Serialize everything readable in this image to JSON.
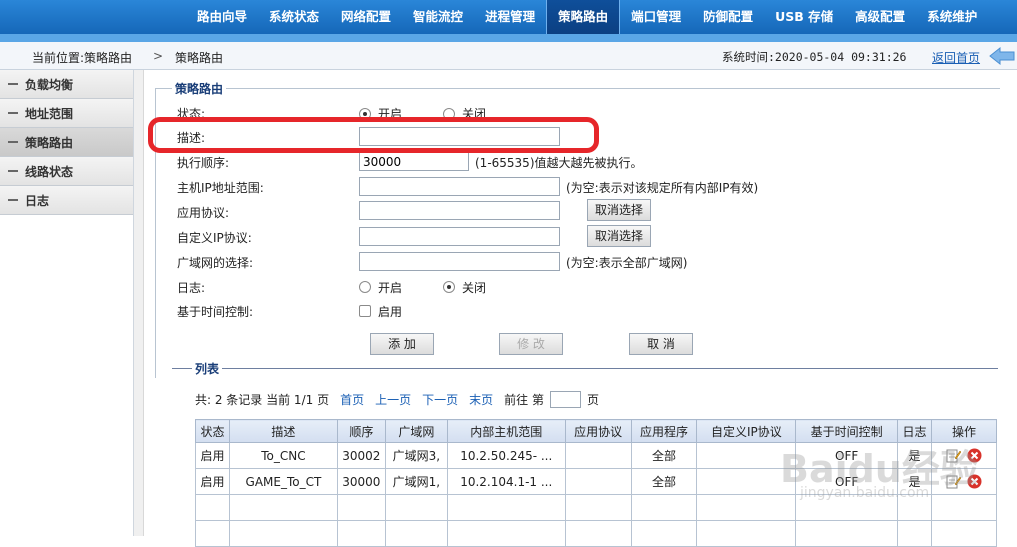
{
  "nav": {
    "items": [
      "路由向导",
      "系统状态",
      "网络配置",
      "智能流控",
      "进程管理",
      "策略路由",
      "端口管理",
      "防御配置",
      "USB 存储",
      "高级配置",
      "系统维护"
    ],
    "active_index": 5
  },
  "breadcrumb": {
    "label": "当前位置:策略路由",
    "separator": ">",
    "page": "策略路由",
    "system_time": "系统时间:2020-05-04 09:31:26",
    "home_link": "返回首页"
  },
  "sidebar": {
    "items": [
      "负载均衡",
      "地址范围",
      "策略路由",
      "线路状态",
      "日志"
    ],
    "active_index": 2
  },
  "form": {
    "legend": "策略路由",
    "status_label": "状态:",
    "status_on": "开启",
    "status_off": "关闭",
    "desc_label": "描述:",
    "desc_value": "",
    "order_label": "执行顺序:",
    "order_value": "30000",
    "order_hint": "(1-65535)值越大越先被执行。",
    "host_ip_label": "主机IP地址范围:",
    "host_ip_value": "",
    "host_ip_hint": "(为空:表示对该规定所有内部IP有效)",
    "app_proto_label": "应用协议:",
    "app_proto_value": "",
    "cancel_select_1": "取消选择",
    "custom_ip_label": "自定义IP协议:",
    "custom_ip_value": "",
    "cancel_select_2": "取消选择",
    "wan_label": "广域网的选择:",
    "wan_value": "",
    "wan_hint": "(为空:表示全部广域网)",
    "log_label": "日志:",
    "log_on": "开启",
    "log_off": "关闭",
    "time_ctrl_label": "基于时间控制:",
    "time_ctrl_enable": "启用",
    "add_button": "添 加",
    "modify_button": "修 改",
    "cancel_button": "取 消"
  },
  "list": {
    "legend": "列表",
    "summary": "共: 2 条记录 当前 1/1 页",
    "first": "首页",
    "prev": "上一页",
    "next": "下一页",
    "last": "末页",
    "goto_prefix": "前往 第",
    "goto_suffix": "页",
    "columns": [
      "状态",
      "描述",
      "顺序",
      "广域网",
      "内部主机范围",
      "应用协议",
      "应用程序",
      "自定义IP协议",
      "基于时间控制",
      "日志",
      "操作"
    ],
    "rows": [
      [
        "启用",
        "To_CNC",
        "30002",
        "广域网3,",
        "10.2.50.245- ...",
        "",
        "全部",
        "",
        "OFF",
        "是"
      ],
      [
        "启用",
        "GAME_To_CT",
        "30000",
        "广域网1,",
        "10.2.104.1-1 ...",
        "",
        "全部",
        "",
        "OFF",
        "是"
      ]
    ]
  },
  "watermark": {
    "main": "Baidu经验",
    "sub": "jingyan.baidu.com"
  }
}
